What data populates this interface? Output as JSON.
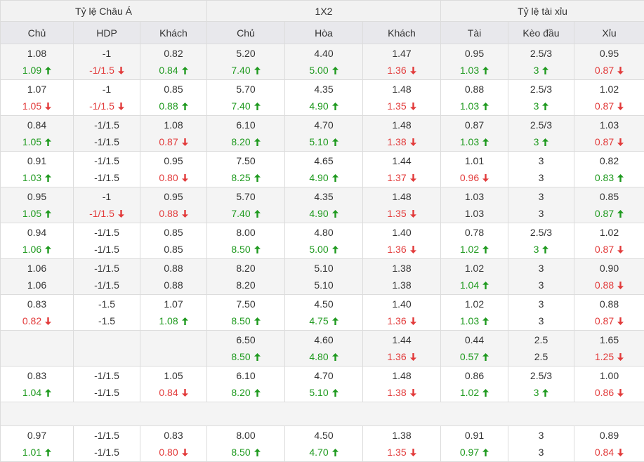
{
  "headers": {
    "groups": [
      "Tỷ lệ Châu Á",
      "1X2",
      "Tỷ lệ tài xỉu"
    ],
    "columns": [
      "Chủ",
      "HDP",
      "Khách",
      "Chủ",
      "Hòa",
      "Khách",
      "Tài",
      "Kèo đầu",
      "Xỉu"
    ]
  },
  "colors": {
    "up": "#1f9a1f",
    "down": "#e23a3a",
    "neutral": "#333333"
  },
  "icons": {
    "up": "arrow-up-icon",
    "down": "arrow-down-icon"
  },
  "rows": [
    {
      "type": "data",
      "cells": [
        {
          "top": "1.08",
          "bottom": "1.09",
          "trend": "up"
        },
        {
          "top": "-1",
          "bottom": "-1/1.5",
          "trend": "down"
        },
        {
          "top": "0.82",
          "bottom": "0.84",
          "trend": "up"
        },
        {
          "top": "5.20",
          "bottom": "7.40",
          "trend": "up"
        },
        {
          "top": "4.40",
          "bottom": "5.00",
          "trend": "up"
        },
        {
          "top": "1.47",
          "bottom": "1.36",
          "trend": "down"
        },
        {
          "top": "0.95",
          "bottom": "1.03",
          "trend": "up"
        },
        {
          "top": "2.5/3",
          "bottom": "3",
          "trend": "up"
        },
        {
          "top": "0.95",
          "bottom": "0.87",
          "trend": "down"
        }
      ]
    },
    {
      "type": "data",
      "cells": [
        {
          "top": "1.07",
          "bottom": "1.05",
          "trend": "down"
        },
        {
          "top": "-1",
          "bottom": "-1/1.5",
          "trend": "down"
        },
        {
          "top": "0.85",
          "bottom": "0.88",
          "trend": "up"
        },
        {
          "top": "5.70",
          "bottom": "7.40",
          "trend": "up"
        },
        {
          "top": "4.35",
          "bottom": "4.90",
          "trend": "up"
        },
        {
          "top": "1.48",
          "bottom": "1.35",
          "trend": "down"
        },
        {
          "top": "0.88",
          "bottom": "1.03",
          "trend": "up"
        },
        {
          "top": "2.5/3",
          "bottom": "3",
          "trend": "up"
        },
        {
          "top": "1.02",
          "bottom": "0.87",
          "trend": "down"
        }
      ]
    },
    {
      "type": "data",
      "cells": [
        {
          "top": "0.84",
          "bottom": "1.05",
          "trend": "up"
        },
        {
          "top": "-1/1.5",
          "bottom": "-1/1.5",
          "trend": "none"
        },
        {
          "top": "1.08",
          "bottom": "0.87",
          "trend": "down"
        },
        {
          "top": "6.10",
          "bottom": "8.20",
          "trend": "up"
        },
        {
          "top": "4.70",
          "bottom": "5.10",
          "trend": "up"
        },
        {
          "top": "1.48",
          "bottom": "1.38",
          "trend": "down"
        },
        {
          "top": "0.87",
          "bottom": "1.03",
          "trend": "up"
        },
        {
          "top": "2.5/3",
          "bottom": "3",
          "trend": "up"
        },
        {
          "top": "1.03",
          "bottom": "0.87",
          "trend": "down"
        }
      ]
    },
    {
      "type": "data",
      "cells": [
        {
          "top": "0.91",
          "bottom": "1.03",
          "trend": "up"
        },
        {
          "top": "-1/1.5",
          "bottom": "-1/1.5",
          "trend": "none"
        },
        {
          "top": "0.95",
          "bottom": "0.80",
          "trend": "down"
        },
        {
          "top": "7.50",
          "bottom": "8.25",
          "trend": "up"
        },
        {
          "top": "4.65",
          "bottom": "4.90",
          "trend": "up"
        },
        {
          "top": "1.44",
          "bottom": "1.37",
          "trend": "down"
        },
        {
          "top": "1.01",
          "bottom": "0.96",
          "trend": "down"
        },
        {
          "top": "3",
          "bottom": "3",
          "trend": "none"
        },
        {
          "top": "0.82",
          "bottom": "0.83",
          "trend": "up"
        }
      ]
    },
    {
      "type": "data",
      "cells": [
        {
          "top": "0.95",
          "bottom": "1.05",
          "trend": "up"
        },
        {
          "top": "-1",
          "bottom": "-1/1.5",
          "trend": "down"
        },
        {
          "top": "0.95",
          "bottom": "0.88",
          "trend": "down"
        },
        {
          "top": "5.70",
          "bottom": "7.40",
          "trend": "up"
        },
        {
          "top": "4.35",
          "bottom": "4.90",
          "trend": "up"
        },
        {
          "top": "1.48",
          "bottom": "1.35",
          "trend": "down"
        },
        {
          "top": "1.03",
          "bottom": "1.03",
          "trend": "none"
        },
        {
          "top": "3",
          "bottom": "3",
          "trend": "none"
        },
        {
          "top": "0.85",
          "bottom": "0.87",
          "trend": "up"
        }
      ]
    },
    {
      "type": "data",
      "cells": [
        {
          "top": "0.94",
          "bottom": "1.06",
          "trend": "up"
        },
        {
          "top": "-1/1.5",
          "bottom": "-1/1.5",
          "trend": "none"
        },
        {
          "top": "0.85",
          "bottom": "0.85",
          "trend": "none"
        },
        {
          "top": "8.00",
          "bottom": "8.50",
          "trend": "up"
        },
        {
          "top": "4.80",
          "bottom": "5.00",
          "trend": "up"
        },
        {
          "top": "1.40",
          "bottom": "1.36",
          "trend": "down"
        },
        {
          "top": "0.78",
          "bottom": "1.02",
          "trend": "up"
        },
        {
          "top": "2.5/3",
          "bottom": "3",
          "trend": "up"
        },
        {
          "top": "1.02",
          "bottom": "0.87",
          "trend": "down"
        }
      ]
    },
    {
      "type": "data",
      "cells": [
        {
          "top": "1.06",
          "bottom": "1.06",
          "trend": "none"
        },
        {
          "top": "-1/1.5",
          "bottom": "-1/1.5",
          "trend": "none"
        },
        {
          "top": "0.88",
          "bottom": "0.88",
          "trend": "none"
        },
        {
          "top": "8.20",
          "bottom": "8.20",
          "trend": "none"
        },
        {
          "top": "5.10",
          "bottom": "5.10",
          "trend": "none"
        },
        {
          "top": "1.38",
          "bottom": "1.38",
          "trend": "none"
        },
        {
          "top": "1.02",
          "bottom": "1.04",
          "trend": "up"
        },
        {
          "top": "3",
          "bottom": "3",
          "trend": "none"
        },
        {
          "top": "0.90",
          "bottom": "0.88",
          "trend": "down"
        }
      ]
    },
    {
      "type": "data",
      "cells": [
        {
          "top": "0.83",
          "bottom": "0.82",
          "trend": "down"
        },
        {
          "top": "-1.5",
          "bottom": "-1.5",
          "trend": "none"
        },
        {
          "top": "1.07",
          "bottom": "1.08",
          "trend": "up"
        },
        {
          "top": "7.50",
          "bottom": "8.50",
          "trend": "up"
        },
        {
          "top": "4.50",
          "bottom": "4.75",
          "trend": "up"
        },
        {
          "top": "1.40",
          "bottom": "1.36",
          "trend": "down"
        },
        {
          "top": "1.02",
          "bottom": "1.03",
          "trend": "up"
        },
        {
          "top": "3",
          "bottom": "3",
          "trend": "none"
        },
        {
          "top": "0.88",
          "bottom": "0.87",
          "trend": "down"
        }
      ]
    },
    {
      "type": "data",
      "cells": [
        {
          "top": "",
          "bottom": "",
          "trend": "none"
        },
        {
          "top": "",
          "bottom": "",
          "trend": "none"
        },
        {
          "top": "",
          "bottom": "",
          "trend": "none"
        },
        {
          "top": "6.50",
          "bottom": "8.50",
          "trend": "up"
        },
        {
          "top": "4.60",
          "bottom": "4.80",
          "trend": "up"
        },
        {
          "top": "1.44",
          "bottom": "1.36",
          "trend": "down"
        },
        {
          "top": "0.44",
          "bottom": "0.57",
          "trend": "up"
        },
        {
          "top": "2.5",
          "bottom": "2.5",
          "trend": "none"
        },
        {
          "top": "1.65",
          "bottom": "1.25",
          "trend": "down"
        }
      ]
    },
    {
      "type": "data",
      "cells": [
        {
          "top": "0.83",
          "bottom": "1.04",
          "trend": "up"
        },
        {
          "top": "-1/1.5",
          "bottom": "-1/1.5",
          "trend": "none"
        },
        {
          "top": "1.05",
          "bottom": "0.84",
          "trend": "down"
        },
        {
          "top": "6.10",
          "bottom": "8.20",
          "trend": "up"
        },
        {
          "top": "4.70",
          "bottom": "5.10",
          "trend": "up"
        },
        {
          "top": "1.48",
          "bottom": "1.38",
          "trend": "down"
        },
        {
          "top": "0.86",
          "bottom": "1.02",
          "trend": "up"
        },
        {
          "top": "2.5/3",
          "bottom": "3",
          "trend": "up"
        },
        {
          "top": "1.00",
          "bottom": "0.86",
          "trend": "down"
        }
      ]
    },
    {
      "type": "blank"
    },
    {
      "type": "data",
      "cells": [
        {
          "top": "0.97",
          "bottom": "1.01",
          "trend": "up"
        },
        {
          "top": "-1/1.5",
          "bottom": "-1/1.5",
          "trend": "none"
        },
        {
          "top": "0.83",
          "bottom": "0.80",
          "trend": "down"
        },
        {
          "top": "8.00",
          "bottom": "8.50",
          "trend": "up"
        },
        {
          "top": "4.50",
          "bottom": "4.70",
          "trend": "up"
        },
        {
          "top": "1.38",
          "bottom": "1.35",
          "trend": "down"
        },
        {
          "top": "0.91",
          "bottom": "0.97",
          "trend": "up"
        },
        {
          "top": "3",
          "bottom": "3",
          "trend": "none"
        },
        {
          "top": "0.89",
          "bottom": "0.84",
          "trend": "down"
        }
      ]
    }
  ]
}
